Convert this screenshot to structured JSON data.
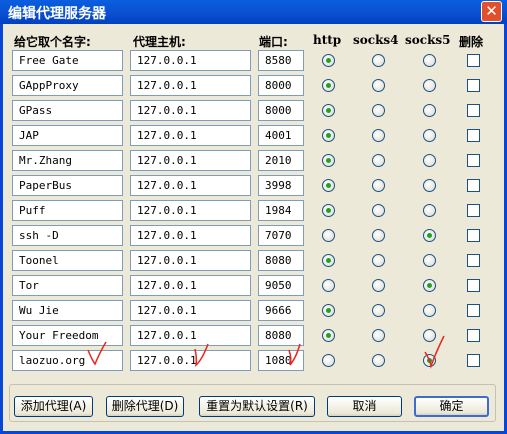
{
  "window": {
    "title": "编辑代理服务器",
    "close_glyph": "✕"
  },
  "headers": {
    "name": "给它取个名字:",
    "host": "代理主机:",
    "port": "端口:",
    "http": "http",
    "socks4": "socks4",
    "socks5": "socks5",
    "delete": "删除"
  },
  "rows": [
    {
      "name": "Free Gate",
      "host": "127.0.0.1",
      "port": "8580",
      "protocol": "http"
    },
    {
      "name": "GAppProxy",
      "host": "127.0.0.1",
      "port": "8000",
      "protocol": "http"
    },
    {
      "name": "GPass",
      "host": "127.0.0.1",
      "port": "8000",
      "protocol": "http"
    },
    {
      "name": "JAP",
      "host": "127.0.0.1",
      "port": "4001",
      "protocol": "http"
    },
    {
      "name": "Mr.Zhang",
      "host": "127.0.0.1",
      "port": "2010",
      "protocol": "http"
    },
    {
      "name": "PaperBus",
      "host": "127.0.0.1",
      "port": "3998",
      "protocol": "http"
    },
    {
      "name": "Puff",
      "host": "127.0.0.1",
      "port": "1984",
      "protocol": "http"
    },
    {
      "name": "ssh -D",
      "host": "127.0.0.1",
      "port": "7070",
      "protocol": "socks5"
    },
    {
      "name": "Toonel",
      "host": "127.0.0.1",
      "port": "8080",
      "protocol": "http"
    },
    {
      "name": "Tor",
      "host": "127.0.0.1",
      "port": "9050",
      "protocol": "socks5"
    },
    {
      "name": "Wu Jie",
      "host": "127.0.0.1",
      "port": "9666",
      "protocol": "http"
    },
    {
      "name": "Your Freedom",
      "host": "127.0.0.1",
      "port": "8080",
      "protocol": "http"
    },
    {
      "name": "laozuo.org",
      "host": "127.0.0.1",
      "port": "1080",
      "protocol": "socks5"
    }
  ],
  "buttons": {
    "add": "添加代理(A)",
    "remove": "删除代理(D)",
    "reset": "重置为默认设置(R)",
    "cancel": "取消",
    "ok": "确定"
  },
  "colors": {
    "titlebar": "#0a5fe0",
    "window_bg": "#ece9d8",
    "radio_on": "#21a121",
    "annotation": "#e8261d"
  }
}
